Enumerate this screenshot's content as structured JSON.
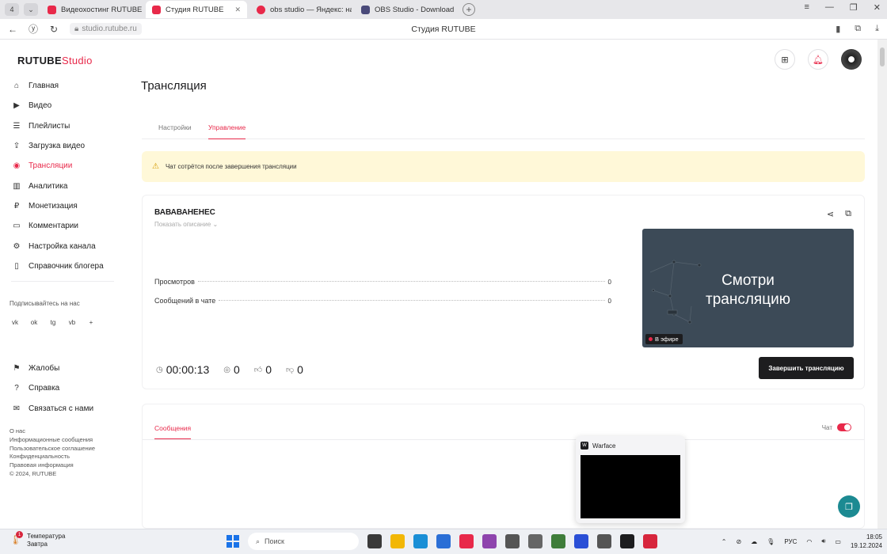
{
  "browser": {
    "tab_counter": "4",
    "tabs": [
      {
        "label": "Видеохостинг RUTUBE. С",
        "color": "#e8294a"
      },
      {
        "label": "Студия RUTUBE",
        "color": "#e8294a"
      },
      {
        "label": "obs studio — Яндекс: наш",
        "color": "#e8294a"
      },
      {
        "label": "OBS Studio - Download an",
        "color": "#4a4a7a"
      }
    ],
    "url": "studio.rutube.ru",
    "page_title": "Студия RUTUBE"
  },
  "header": {
    "logo_main": "RUTUBE",
    "logo_sub": "Studio"
  },
  "sidebar": {
    "items": [
      {
        "label": "Главная",
        "icon": "home-icon",
        "glyph": "⌂"
      },
      {
        "label": "Видео",
        "icon": "video-icon",
        "glyph": "▶"
      },
      {
        "label": "Плейлисты",
        "icon": "playlist-icon",
        "glyph": "☰"
      },
      {
        "label": "Загрузка видео",
        "icon": "upload-icon",
        "glyph": "⇪"
      },
      {
        "label": "Трансляции",
        "icon": "broadcast-icon",
        "glyph": "◉"
      },
      {
        "label": "Аналитика",
        "icon": "analytics-icon",
        "glyph": "▥"
      },
      {
        "label": "Монетизация",
        "icon": "money-icon",
        "glyph": "₽"
      },
      {
        "label": "Комментарии",
        "icon": "comments-icon",
        "glyph": "▭"
      },
      {
        "label": "Настройка канала",
        "icon": "settings-icon",
        "glyph": "⚙"
      },
      {
        "label": "Справочник блогера",
        "icon": "guide-icon",
        "glyph": "▯"
      }
    ],
    "active_index": 4,
    "follow_label": "Подписывайтесь на нас",
    "socials": [
      "vk",
      "ok",
      "tg",
      "vb",
      "+"
    ],
    "bottom_items": [
      {
        "label": "Жалобы",
        "icon": "flag-icon",
        "glyph": "⚑"
      },
      {
        "label": "Справка",
        "icon": "help-icon",
        "glyph": "?"
      },
      {
        "label": "Связаться с нами",
        "icon": "mail-icon",
        "glyph": "✉"
      }
    ],
    "links": [
      "О нас",
      "Информационные сообщения",
      "Пользовательское соглашение",
      "Конфиденциальность",
      "Правовая информация",
      "© 2024, RUTUBE"
    ]
  },
  "main": {
    "title": "Трансляция",
    "tabs": [
      "Настройки",
      "Управление"
    ],
    "warning": "Чат сотрётся после завершения трансляции",
    "stream": {
      "name": "ВАВАВАНЕНЕС",
      "show_description": "Показать описание",
      "stats": [
        {
          "label": "Просмотров",
          "value": "0"
        },
        {
          "label": "Сообщений в чате",
          "value": "0"
        }
      ],
      "preview_line1": "Смотри",
      "preview_line2": "трансляцию",
      "live_badge": "В эфире",
      "timer": "00:00:13",
      "viewers": "0",
      "likes": "0",
      "dislikes": "0",
      "end_button": "Завершить трансляцию"
    },
    "messages_tab": "Сообщения",
    "chat_label": "Чат",
    "chat_enabled": true
  },
  "popup": {
    "title": "Warface"
  },
  "taskbar": {
    "weather_title": "Температура",
    "weather_sub": "Завтра",
    "weather_badge": "1",
    "search_placeholder": "Поиск",
    "lang": "РУС",
    "time": "18:05",
    "date": "19.12.2024",
    "apps": [
      "#3a3a3a",
      "#f2b705",
      "#1a8fd6",
      "#2b6fd6",
      "#e8294a",
      "#8e44ad",
      "#555555",
      "#666666",
      "#3f7d3a",
      "#2a4fd6",
      "#555555",
      "#1d1d1f",
      "#d7263d"
    ]
  }
}
